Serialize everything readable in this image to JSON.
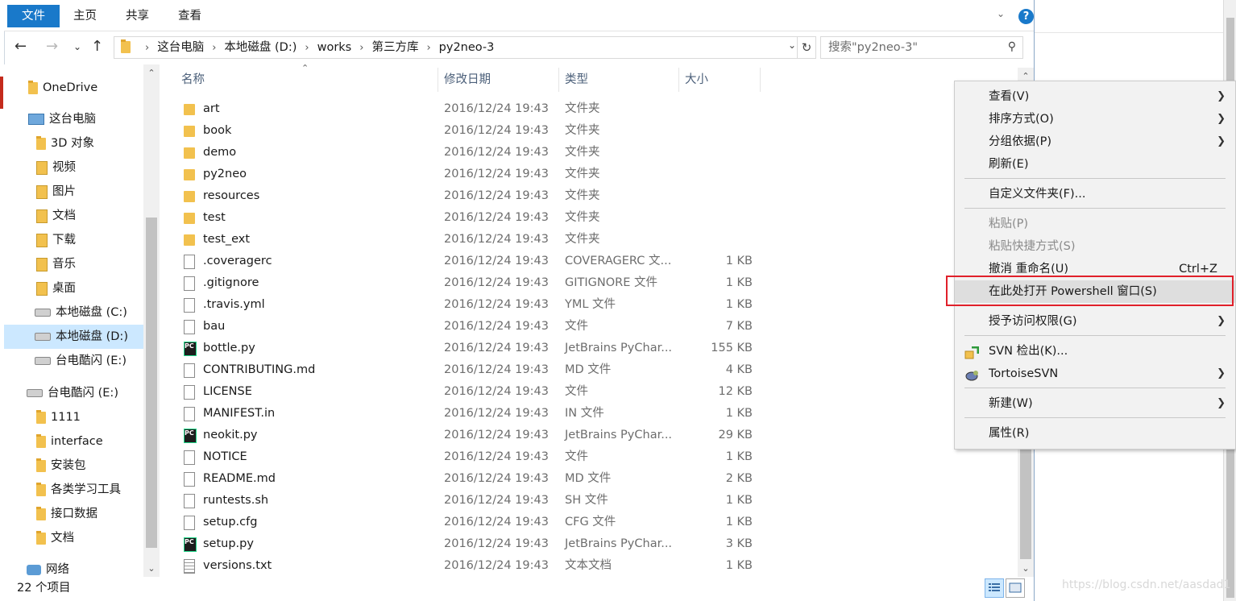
{
  "ribbon": {
    "tabs": [
      "文件",
      "主页",
      "共享",
      "查看"
    ]
  },
  "address": {
    "crumbs": [
      "这台电脑",
      "本地磁盘 (D:)",
      "works",
      "第三方库",
      "py2neo-3"
    ]
  },
  "search": {
    "placeholder": "搜索\"py2neo-3\""
  },
  "nav": {
    "items": [
      {
        "label": "OneDrive",
        "icon": "folder-icon"
      },
      {
        "label": "这台电脑",
        "icon": "computer-icon"
      },
      {
        "label": "3D 对象",
        "icon": "folder-icon"
      },
      {
        "label": "视频",
        "icon": "video-folder-icon"
      },
      {
        "label": "图片",
        "icon": "pictures-folder-icon"
      },
      {
        "label": "文档",
        "icon": "documents-folder-icon"
      },
      {
        "label": "下载",
        "icon": "downloads-folder-icon"
      },
      {
        "label": "音乐",
        "icon": "music-folder-icon"
      },
      {
        "label": "桌面",
        "icon": "desktop-folder-icon"
      },
      {
        "label": "本地磁盘 (C:)",
        "icon": "drive-icon"
      },
      {
        "label": "本地磁盘 (D:)",
        "icon": "drive-icon",
        "selected": true
      },
      {
        "label": "台电酷闪 (E:)",
        "icon": "usb-drive-icon"
      },
      {
        "label": "台电酷闪 (E:)",
        "icon": "usb-drive-icon"
      },
      {
        "label": "1111",
        "icon": "folder-icon"
      },
      {
        "label": "interface",
        "icon": "folder-icon"
      },
      {
        "label": "安装包",
        "icon": "folder-icon"
      },
      {
        "label": "各类学习工具",
        "icon": "folder-icon"
      },
      {
        "label": "接口数据",
        "icon": "folder-icon"
      },
      {
        "label": "文档",
        "icon": "folder-icon"
      },
      {
        "label": "网络",
        "icon": "network-icon"
      }
    ]
  },
  "columns": [
    "名称",
    "修改日期",
    "类型",
    "大小"
  ],
  "files": [
    {
      "name": "art",
      "date": "2016/12/24 19:43",
      "type": "文件夹",
      "size": "",
      "icon": "folder"
    },
    {
      "name": "book",
      "date": "2016/12/24 19:43",
      "type": "文件夹",
      "size": "",
      "icon": "folder"
    },
    {
      "name": "demo",
      "date": "2016/12/24 19:43",
      "type": "文件夹",
      "size": "",
      "icon": "folder"
    },
    {
      "name": "py2neo",
      "date": "2016/12/24 19:43",
      "type": "文件夹",
      "size": "",
      "icon": "folder"
    },
    {
      "name": "resources",
      "date": "2016/12/24 19:43",
      "type": "文件夹",
      "size": "",
      "icon": "folder"
    },
    {
      "name": "test",
      "date": "2016/12/24 19:43",
      "type": "文件夹",
      "size": "",
      "icon": "folder"
    },
    {
      "name": "test_ext",
      "date": "2016/12/24 19:43",
      "type": "文件夹",
      "size": "",
      "icon": "folder"
    },
    {
      "name": ".coveragerc",
      "date": "2016/12/24 19:43",
      "type": "COVERAGERC 文...",
      "size": "1 KB",
      "icon": "file"
    },
    {
      "name": ".gitignore",
      "date": "2016/12/24 19:43",
      "type": "GITIGNORE 文件",
      "size": "1 KB",
      "icon": "file"
    },
    {
      "name": ".travis.yml",
      "date": "2016/12/24 19:43",
      "type": "YML 文件",
      "size": "1 KB",
      "icon": "file"
    },
    {
      "name": "bau",
      "date": "2016/12/24 19:43",
      "type": "文件",
      "size": "7 KB",
      "icon": "file"
    },
    {
      "name": "bottle.py",
      "date": "2016/12/24 19:43",
      "type": "JetBrains PyChar...",
      "size": "155 KB",
      "icon": "pycharm"
    },
    {
      "name": "CONTRIBUTING.md",
      "date": "2016/12/24 19:43",
      "type": "MD 文件",
      "size": "4 KB",
      "icon": "file"
    },
    {
      "name": "LICENSE",
      "date": "2016/12/24 19:43",
      "type": "文件",
      "size": "12 KB",
      "icon": "file"
    },
    {
      "name": "MANIFEST.in",
      "date": "2016/12/24 19:43",
      "type": "IN 文件",
      "size": "1 KB",
      "icon": "file"
    },
    {
      "name": "neokit.py",
      "date": "2016/12/24 19:43",
      "type": "JetBrains PyChar...",
      "size": "29 KB",
      "icon": "pycharm"
    },
    {
      "name": "NOTICE",
      "date": "2016/12/24 19:43",
      "type": "文件",
      "size": "1 KB",
      "icon": "file"
    },
    {
      "name": "README.md",
      "date": "2016/12/24 19:43",
      "type": "MD 文件",
      "size": "2 KB",
      "icon": "file"
    },
    {
      "name": "runtests.sh",
      "date": "2016/12/24 19:43",
      "type": "SH 文件",
      "size": "1 KB",
      "icon": "file"
    },
    {
      "name": "setup.cfg",
      "date": "2016/12/24 19:43",
      "type": "CFG 文件",
      "size": "1 KB",
      "icon": "file"
    },
    {
      "name": "setup.py",
      "date": "2016/12/24 19:43",
      "type": "JetBrains PyChar...",
      "size": "3 KB",
      "icon": "pycharm"
    },
    {
      "name": "versions.txt",
      "date": "2016/12/24 19:43",
      "type": "文本文档",
      "size": "1 KB",
      "icon": "text"
    }
  ],
  "status": {
    "count": "22 个项目"
  },
  "watermark": "https://blog.csdn.net/aasdad1",
  "context_menu": {
    "items": [
      {
        "label": "查看(V)",
        "submenu": true
      },
      {
        "label": "排序方式(O)",
        "submenu": true
      },
      {
        "label": "分组依据(P)",
        "submenu": true
      },
      {
        "label": "刷新(E)"
      },
      {
        "label": "自定义文件夹(F)..."
      },
      {
        "label": "粘贴(P)",
        "disabled": true
      },
      {
        "label": "粘贴快捷方式(S)",
        "disabled": true
      },
      {
        "label": "撤消 重命名(U)",
        "shortcut": "Ctrl+Z"
      },
      {
        "label": "在此处打开 Powershell 窗口(S)",
        "highlighted": true
      },
      {
        "label": "授予访问权限(G)",
        "submenu": true
      },
      {
        "label": "SVN 检出(K)...",
        "icon": "svn-checkout-icon"
      },
      {
        "label": "TortoiseSVN",
        "submenu": true,
        "icon": "tortoisesvn-icon"
      },
      {
        "label": "新建(W)",
        "submenu": true
      },
      {
        "label": "属性(R)"
      }
    ]
  }
}
